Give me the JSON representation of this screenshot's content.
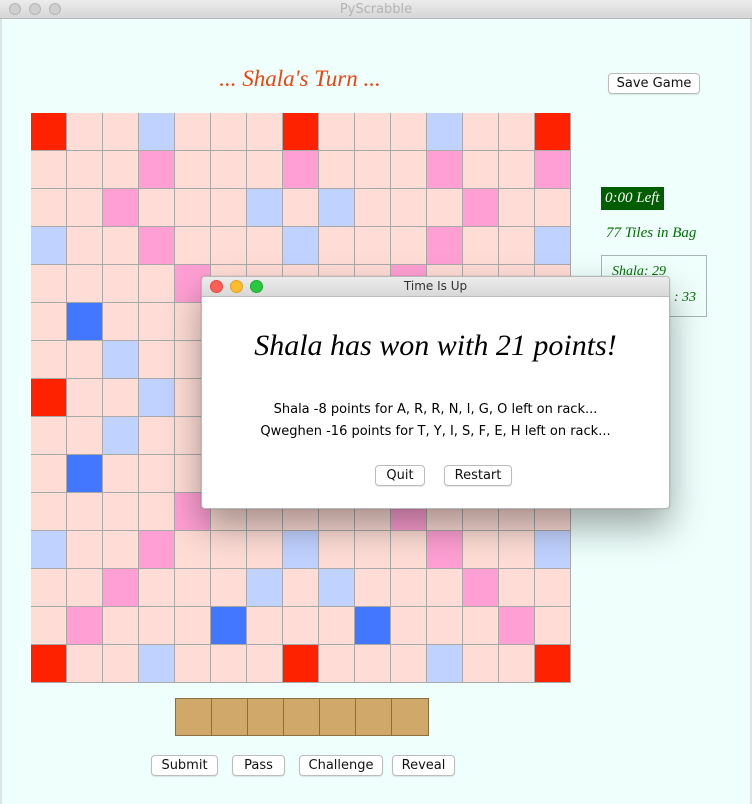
{
  "window": {
    "title": "PyScrabble"
  },
  "turn_label": "... Shala's Turn ...",
  "buttons": {
    "save_game": "Save Game",
    "submit": "Submit",
    "pass": "Pass",
    "challenge": "Challenge",
    "reveal": "Reveal"
  },
  "sidebar": {
    "timer": "0:00 Left",
    "tiles_in_bag": "77 Tiles in Bag",
    "score_line_1": "Shala: 29",
    "score_line_2": ": 33"
  },
  "colors": {
    "normal": "#ffddd6",
    "triple_word": "#ff2200",
    "double_word": "#ff9fd3",
    "triple_letter": "#4477ff",
    "double_letter": "#c0d2ff",
    "turn_text": "#ee4411",
    "timer_bg": "#005e00",
    "rack_tile": "#cfa86a"
  },
  "board": {
    "size": 15,
    "layout": [
      "T..d...T...d..T",
      "...D...D...D..D",
      "..D...d.d...D..",
      "d..D...d...D..d",
      "....D.....D....",
      ".t...t...t...t.",
      "..d...d.d...d..",
      "T..d...D...d..T",
      "..d...d.d...d..",
      ".t...t...t...t.",
      "....D.....D....",
      "d..D...d...D..d",
      "..D...d.d...D..",
      ".D...t...t...D.",
      "T..d...T...d..T"
    ]
  },
  "rack": {
    "slots": 7
  },
  "dialog": {
    "title": "Time Is Up",
    "message": "Shala has won with 21 points!",
    "detail_1": "Shala -8 points for A, R, R, N, I, G, O left on rack...",
    "detail_2": "Qweghen -16 points for T, Y, I, S, F, E, H left on rack...",
    "quit": "Quit",
    "restart": "Restart"
  }
}
